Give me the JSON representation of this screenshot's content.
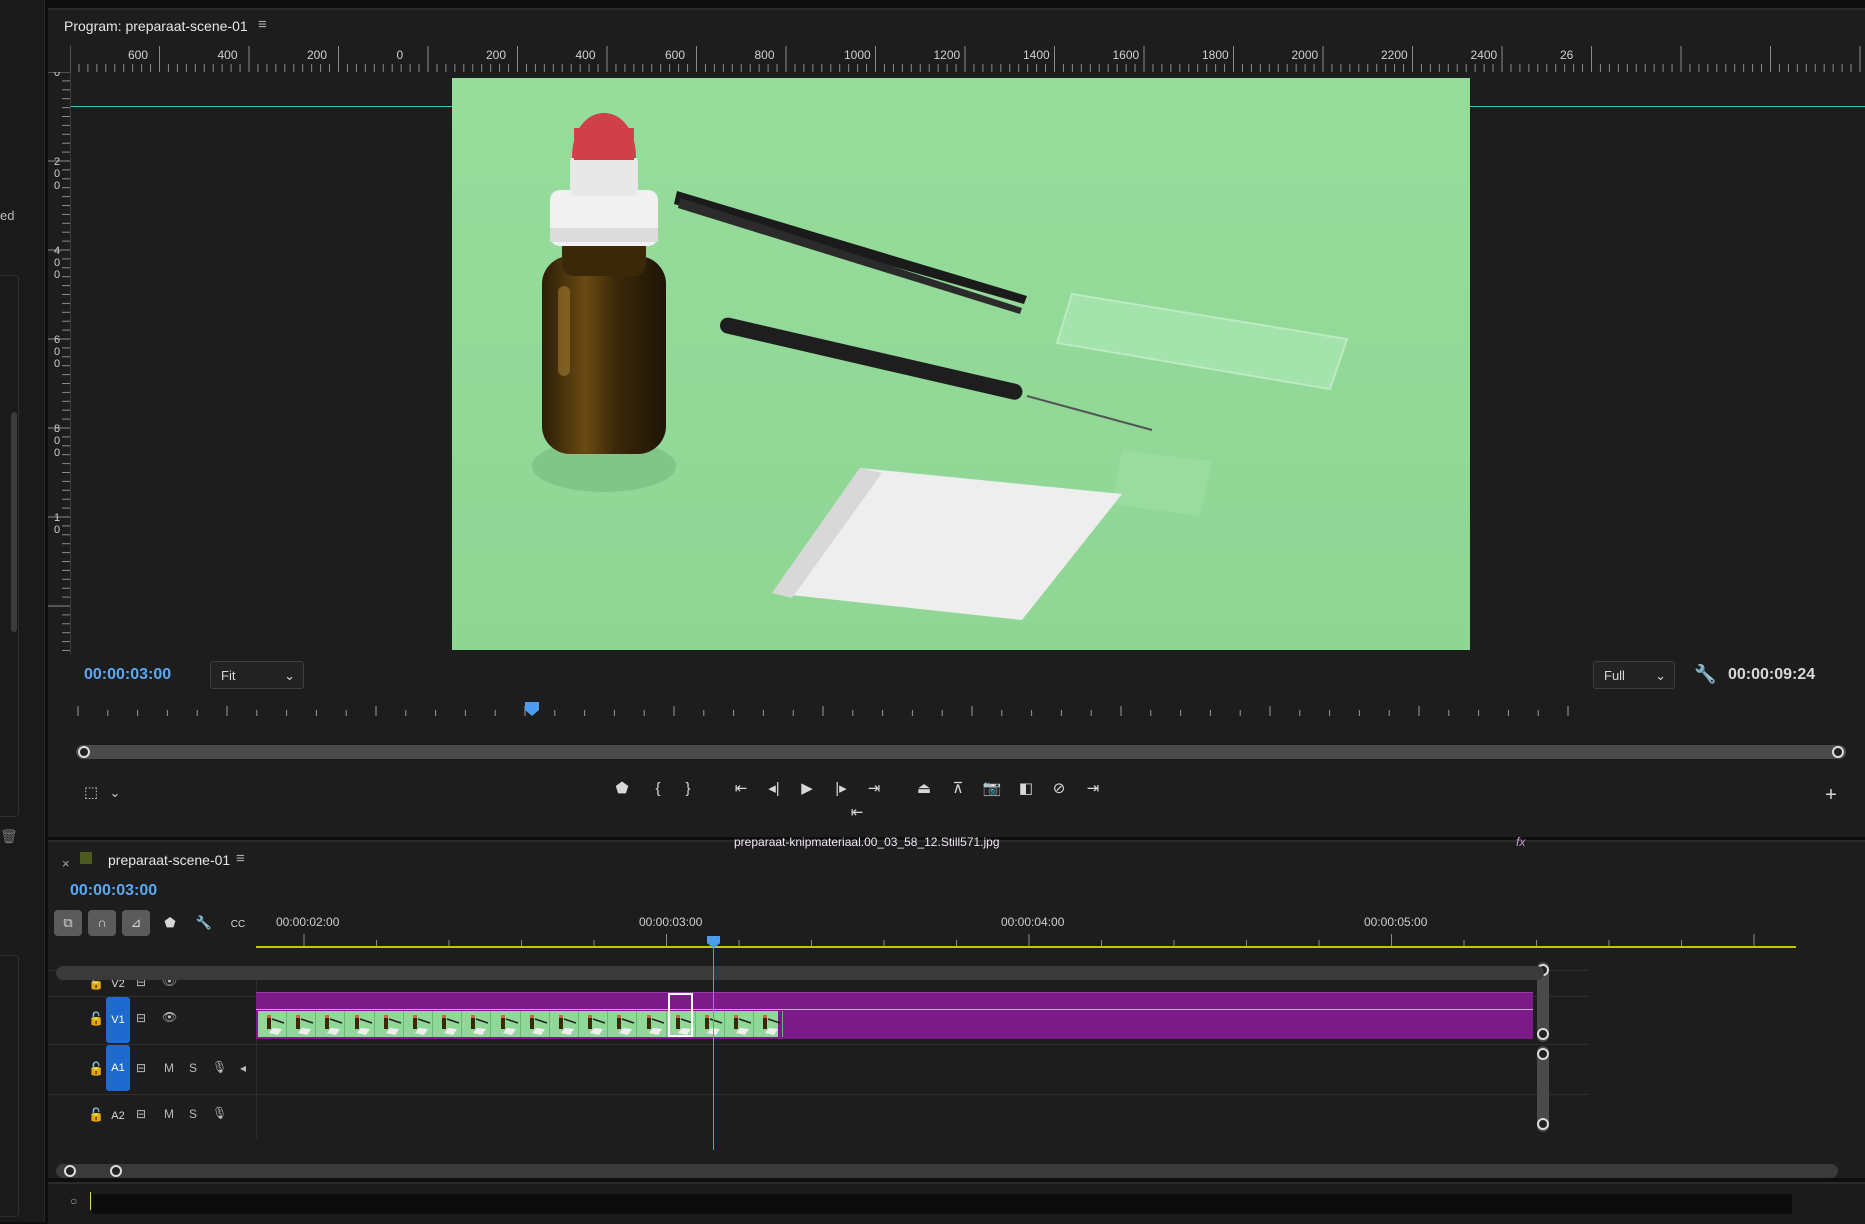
{
  "left_panel": {
    "cut_text": "ed"
  },
  "program": {
    "title": "Program: preparaat-scene-01",
    "menu_icon": "hamburger-menu-icon",
    "ruler_labels": [
      "600",
      "400",
      "200",
      "0",
      "200",
      "400",
      "600",
      "800",
      "1000",
      "1200",
      "1400",
      "1600",
      "1800",
      "2000",
      "2200",
      "2400",
      "26"
    ],
    "vertical_ruler_labels": [
      "0",
      "200",
      "400",
      "600",
      "800",
      "10"
    ],
    "current_timecode": "00:00:03:00",
    "zoom": "Fit",
    "quality": "Full",
    "duration_timecode": "00:00:09:24",
    "playhead_position": 0.305,
    "guide_color": "#33c4c4",
    "transport_buttons": [
      {
        "name": "add-marker-button",
        "icon": "marker-icon"
      },
      {
        "name": "mark-in-button",
        "icon": "mark-in-icon"
      },
      {
        "name": "mark-out-button",
        "icon": "mark-out-icon"
      },
      {
        "name": "go-to-in-button",
        "icon": "go-to-in-icon"
      },
      {
        "name": "step-back-button",
        "icon": "step-back-icon"
      },
      {
        "name": "play-button",
        "icon": "play-icon"
      },
      {
        "name": "step-forward-button",
        "icon": "step-forward-icon"
      },
      {
        "name": "go-to-out-button",
        "icon": "go-to-out-icon"
      },
      {
        "name": "lift-button",
        "icon": "lift-icon"
      },
      {
        "name": "extract-button",
        "icon": "extract-icon"
      },
      {
        "name": "export-frame-button",
        "icon": "camera-icon"
      },
      {
        "name": "comparison-view-button",
        "icon": "comparison-icon"
      },
      {
        "name": "vr-video-button",
        "icon": "vr-icon"
      },
      {
        "name": "go-to-end-button",
        "icon": "go-to-end-icon"
      }
    ]
  },
  "timeline": {
    "sequence_name": "preparaat-scene-01",
    "timecode": "00:00:03:00",
    "time_labels": [
      "00:00:02:00",
      "00:00:03:00",
      "00:00:04:00",
      "00:00:05:00"
    ],
    "tools": [
      {
        "name": "insert-overwrite-tool",
        "icon": "nest-icon",
        "active": true
      },
      {
        "name": "snap-tool",
        "icon": "magnet-icon",
        "active": true
      },
      {
        "name": "linked-selection-tool",
        "icon": "linked-selection-icon",
        "active": true
      },
      {
        "name": "add-marker-tool",
        "icon": "marker-icon",
        "active": false
      },
      {
        "name": "timeline-settings-tool",
        "icon": "wrench-icon",
        "active": false
      },
      {
        "name": "captions-tool",
        "icon": "cc-icon",
        "active": false
      }
    ],
    "tracks": [
      {
        "id": "V2",
        "type": "video",
        "targeted": false
      },
      {
        "id": "V1",
        "type": "video",
        "targeted": true
      },
      {
        "id": "A1",
        "type": "audio",
        "targeted": true
      },
      {
        "id": "A2",
        "type": "audio",
        "targeted": false
      }
    ],
    "audio_track_buttons": [
      "M",
      "S"
    ],
    "clip": {
      "name": "preparaat-knipmateriaal.00_03_58_12.Still571.jpg",
      "fx_badge": "fx",
      "color": "#7a1b87"
    },
    "work_area_color": "#c6c600"
  }
}
